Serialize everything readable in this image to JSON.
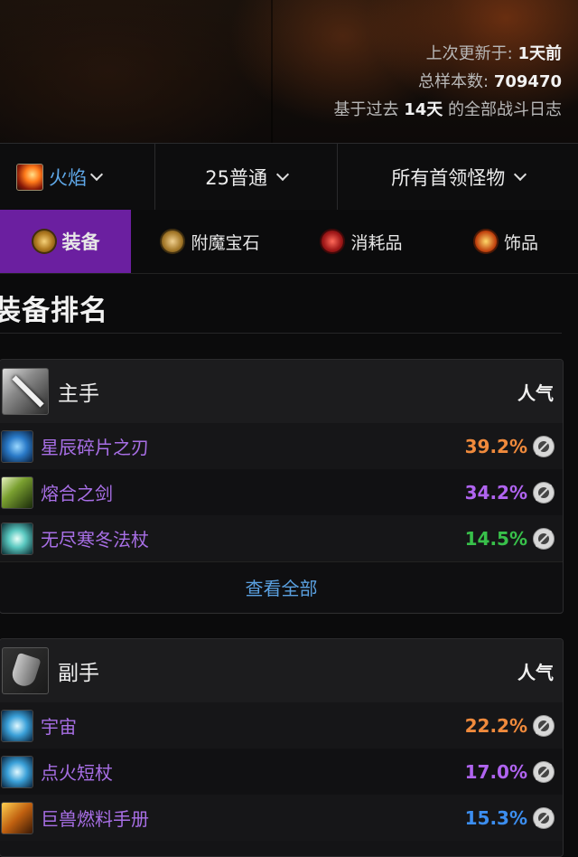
{
  "hero": {
    "last_update_label": "上次更新于:",
    "last_update_value": "1天前",
    "sample_label": "总样本数:",
    "sample_value": "709470",
    "window_prefix": "基于过去",
    "window_value": "14天",
    "window_suffix": "的全部战斗日志"
  },
  "filters": {
    "spec": "火焰",
    "difficulty": "25普通",
    "bosses": "所有首领怪物"
  },
  "tabs": [
    {
      "label": "装备",
      "icon": "gear-icon",
      "active": true
    },
    {
      "label": "附魔宝石",
      "icon": "gem-icon",
      "active": false
    },
    {
      "label": "消耗品",
      "icon": "potion-icon",
      "active": false
    },
    {
      "label": "饰品",
      "icon": "trinket-icon",
      "active": false
    }
  ],
  "page_title": "装备排名",
  "cards": [
    {
      "title": "主手",
      "popularity_label": "人气",
      "icon": "sword-icon",
      "items": [
        {
          "name": "星辰碎片之刃",
          "pct": "39.2%",
          "color": "#f08a3c"
        },
        {
          "name": "熔合之剑",
          "pct": "34.2%",
          "color": "#b064f0"
        },
        {
          "name": "无尽寒冬法杖",
          "pct": "14.5%",
          "color": "#38c04a"
        }
      ],
      "view_all": "查看全部"
    },
    {
      "title": "副手",
      "popularity_label": "人气",
      "icon": "shield-icon",
      "items": [
        {
          "name": "宇宙",
          "pct": "22.2%",
          "color": "#f08a3c"
        },
        {
          "name": "点火短杖",
          "pct": "17.0%",
          "color": "#b064f0"
        },
        {
          "name": "巨兽燃料手册",
          "pct": "15.3%",
          "color": "#3c8ef0"
        }
      ]
    }
  ]
}
